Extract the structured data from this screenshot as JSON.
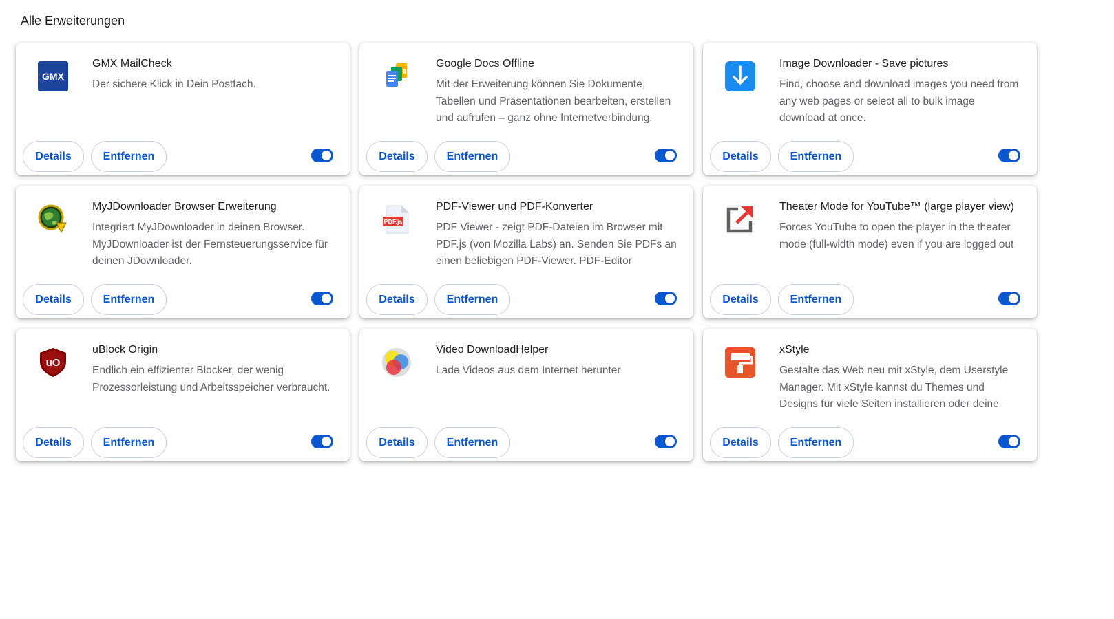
{
  "page": {
    "section_title": "Alle Erweiterungen"
  },
  "accent_color": "#0b57d0",
  "extensions": [
    {
      "name": "GMX MailCheck",
      "description": "Der sichere Klick in Dein Postfach.",
      "icon": "gmx-icon",
      "icon_text": "GMX",
      "details_label": "Details",
      "remove_label": "Entfernen",
      "enabled": true
    },
    {
      "name": "Google Docs Offline",
      "description": "Mit der Erweiterung können Sie Dokumente, Tabellen und Präsentationen bearbeiten, erstellen und aufrufen – ganz ohne Internetverbindung.",
      "icon": "google-docs-offline-icon",
      "details_label": "Details",
      "remove_label": "Entfernen",
      "enabled": true
    },
    {
      "name": "Image Downloader - Save pictures",
      "description": "Find, choose and download images you need from any web pages or select all to bulk image download at once.",
      "icon": "download-arrow-icon",
      "details_label": "Details",
      "remove_label": "Entfernen",
      "enabled": true
    },
    {
      "name": "MyJDownloader Browser Erweiterung",
      "description": "Integriert MyJDownloader in deinen Browser. MyJDownloader ist der Fernsteuerungsservice für deinen JDownloader.",
      "icon": "globe-download-icon",
      "details_label": "Details",
      "remove_label": "Entfernen",
      "enabled": true
    },
    {
      "name": "PDF-Viewer und PDF-Konverter",
      "description": "PDF Viewer - zeigt PDF-Dateien im Browser mit PDF.js (von Mozilla Labs) an. Senden Sie PDFs an einen beliebigen PDF-Viewer. PDF-Editor",
      "icon": "pdf-file-icon",
      "icon_text": "PDF.js",
      "details_label": "Details",
      "remove_label": "Entfernen",
      "enabled": true
    },
    {
      "name": "Theater Mode for YouTube™ (large player view)",
      "description": "Forces YouTube to open the player in the theater mode (full-width mode) even if you are logged out",
      "icon": "expand-arrow-icon",
      "details_label": "Details",
      "remove_label": "Entfernen",
      "enabled": true
    },
    {
      "name": "uBlock Origin",
      "description": "Endlich ein effizienter Blocker, der wenig Prozessorleistung und Arbeitsspeicher verbraucht.",
      "icon": "ublock-shield-icon",
      "icon_text": "uO",
      "details_label": "Details",
      "remove_label": "Entfernen",
      "enabled": true
    },
    {
      "name": "Video DownloadHelper",
      "description": "Lade Videos aus dem Internet herunter",
      "icon": "colored-circles-icon",
      "details_label": "Details",
      "remove_label": "Entfernen",
      "enabled": true
    },
    {
      "name": "xStyle",
      "description": "Gestalte das Web neu mit xStyle, dem Userstyle Manager. Mit xStyle kannst du Themes und Designs für viele Seiten installieren oder deine",
      "icon": "paint-roller-icon",
      "details_label": "Details",
      "remove_label": "Entfernen",
      "enabled": true
    }
  ]
}
